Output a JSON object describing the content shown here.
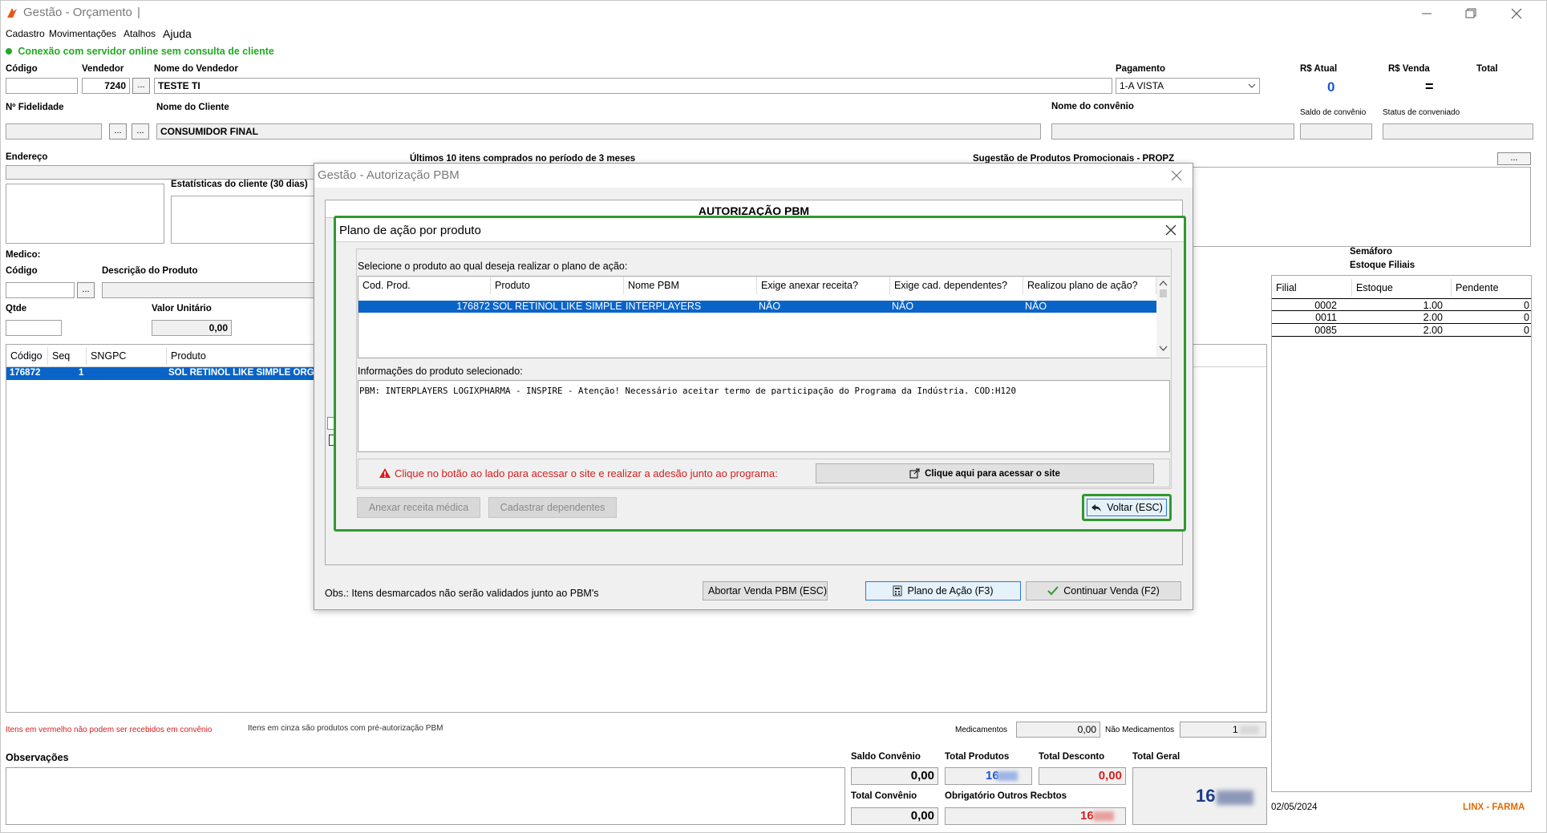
{
  "app": {
    "title": "Gestão - Orçamento",
    "title_cursor": "|",
    "menu": [
      "Cadastro",
      "Movimentações",
      "Atalhos",
      "Ajuda"
    ],
    "status_message": "Conexão com servidor online sem consulta de cliente"
  },
  "form": {
    "codigo_label": "Código",
    "vendedor_label": "Vendedor",
    "vendedor_value": "7240",
    "nome_vendedor_label": "Nome do Vendedor",
    "nome_vendedor_value": "TESTE TI",
    "pagamento_label": "Pagamento",
    "pagamento_value": "1-A VISTA",
    "rs_atual_label": "R$ Atual",
    "rs_atual_value": "0",
    "rs_venda_label": "R$ Venda",
    "rs_venda_value": "=",
    "total_label": "Total",
    "fidelidade_label": "Nº Fidelidade",
    "nome_cliente_label": "Nome do Cliente",
    "nome_cliente_value": "CONSUMIDOR FINAL",
    "nome_convenio_label": "Nome do convênio",
    "saldo_convenio_label": "Saldo de convênio",
    "status_conveniado_label": "Status de conveniado",
    "endereco_label": "Endereço",
    "ultimos_itens_label": "Últimos 10 itens comprados no período de 3 meses",
    "sugestao_label": "Sugestão de Produtos Promocionais - PROPZ",
    "estatisticas_label": "Estatísticas do cliente  (30 dias)",
    "medico_label": "Medico:",
    "codigo2_label": "Código",
    "descricao_label": "Descrição do Produto",
    "qtde_label": "Qtde",
    "valor_unitario_label": "Valor Unitário",
    "valor_unitario_value": "0,00",
    "dots": "..."
  },
  "items_table": {
    "headers": [
      "Código",
      "Seq",
      "SNGPC",
      "Produto"
    ],
    "row": [
      "176872",
      "1",
      "",
      "SOL RETINOL LIKE SIMPLE ORGAN"
    ]
  },
  "semaforo": {
    "title": "Semáforo",
    "subtitle": "Estoque Filiais",
    "headers": [
      "Filial",
      "Estoque",
      "Pendente"
    ],
    "rows": [
      [
        "0002",
        "1.00",
        "0"
      ],
      [
        "0011",
        "2.00",
        "0"
      ],
      [
        "0085",
        "2.00",
        "0"
      ]
    ]
  },
  "footer": {
    "red_note": "Itens em vermelho não podem ser recebidos em convênio",
    "gray_note": "Itens em cinza são produtos com pré-autorização PBM",
    "medicamentos_label": "Medicamentos",
    "medicamentos_value": "0,00",
    "nao_medicamentos_label": "Não Medicamentos",
    "nao_medicamentos_value": "1",
    "observacoes_label": "Observações",
    "saldo_convenio_label": "Saldo Convênio",
    "saldo_convenio_value": "0,00",
    "total_produtos_label": "Total Produtos",
    "total_produtos_value": "16",
    "total_desconto_label": "Total Desconto",
    "total_desconto_value": "0,00",
    "total_geral_label": "Total Geral",
    "total_geral_value": "16",
    "total_convenio_label": "Total Convênio",
    "total_convenio_value": "0,00",
    "obrigatorio_label": "Obrigatório Outros Recbtos",
    "obrigatorio_value": "16",
    "date": "02/05/2024",
    "brand": "LINX - FARMA"
  },
  "pbm_dialog": {
    "title": "Gestão - Autorização PBM",
    "header": "AUTORIZAÇÃO PBM",
    "obs": "Obs.: Itens desmarcados não serão validados junto ao PBM's",
    "abortar_label": "Abortar Venda PBM (ESC)",
    "plano_label": "Plano de Ação (F3)",
    "continuar_label": "Continuar Venda (F2)"
  },
  "plano_dialog": {
    "title": "Plano de ação por produto",
    "prompt": "Selecione o produto ao qual deseja realizar o plano de ação:",
    "headers": [
      "Cod. Prod.",
      "Produto",
      "Nome PBM",
      "Exige anexar receita?",
      "Exige cad. dependentes?",
      "Realizou plano de ação?"
    ],
    "row": [
      "176872",
      "SOL RETINOL LIKE SIMPLE...",
      "INTERPLAYERS",
      "NÃO",
      "NÃO",
      "NÃO"
    ],
    "info_label": "Informações do produto selecionado:",
    "info_text": "PBM: INTERPLAYERS LOGIXPHARMA - INSPIRE - Atenção! Necessário aceitar termo de participação do Programa da Indústria. COD:H120",
    "warning": "Clique no botão ao lado para acessar o site e realizar a adesão junto ao programa:",
    "site_button": "Clique aqui para acessar o site",
    "anexar_button": "Anexar receita médica",
    "cadastrar_button": "Cadastrar dependentes",
    "voltar_button": "Voltar (ESC)"
  },
  "colors": {
    "status_green": "#22aa22",
    "selection_blue": "#0a64c8",
    "highlight_green": "#2e9a2e",
    "warning_red": "#d42020",
    "brand_orange": "#e06a00"
  }
}
